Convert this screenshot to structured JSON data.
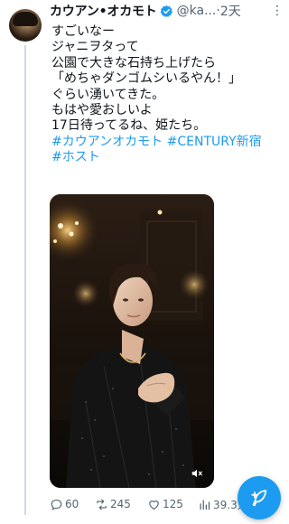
{
  "tweet": {
    "display_name": "カウアン•オカモト",
    "handle": "@ka...",
    "separator": "·",
    "time": "2天",
    "text_lines": [
      "すごいなー",
      "ジャニヲタって",
      "公園で大きな石持ち上げたら",
      "「めちゃダンゴムシいるやん！」",
      "ぐらい湧いてきた。",
      "もはや愛おしいよ",
      "17日待ってるね、姫たち。"
    ],
    "hashtags_line1": [
      "#カウアンオカモト",
      "#CENTURY新宿"
    ],
    "hashtags_line2": [
      "#ホスト"
    ]
  },
  "actions": {
    "replies": "60",
    "retweets": "245",
    "likes": "125",
    "views": "39.3万"
  },
  "colors": {
    "accent": "#1d9bf0",
    "text": "#0f1419",
    "muted": "#536471"
  },
  "icons": {
    "verified": "verified-badge-icon",
    "more": "more-icon",
    "reply": "reply-icon",
    "retweet": "retweet-icon",
    "like": "like-icon",
    "views": "views-icon",
    "mute": "mute-icon",
    "compose": "compose-feather-icon"
  }
}
